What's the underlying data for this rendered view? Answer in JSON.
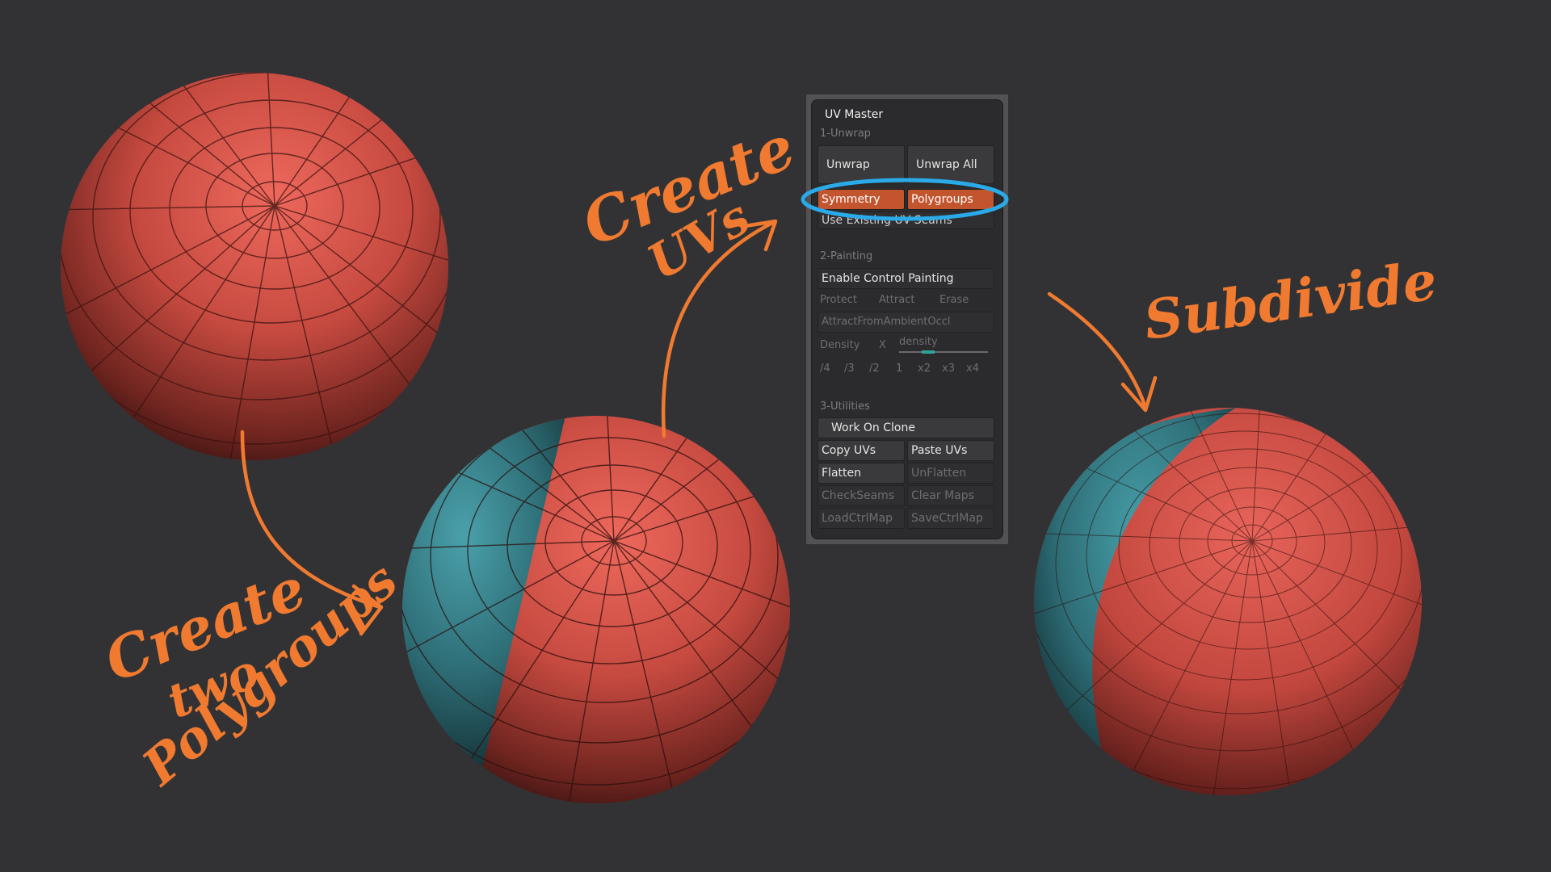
{
  "annotations": {
    "create_uvs_line1": "Create",
    "create_uvs_line2": "UVs",
    "subdivide": "Subdivide",
    "create_polygroups_line1": "Create",
    "create_polygroups_line2": "two",
    "create_polygroups_line3": "Polygroups",
    "color": "#f07a30",
    "highlight_color": "#2aaae8"
  },
  "uv_master": {
    "title": "UV Master",
    "unwrap_header": "1-Unwrap",
    "unwrap": "Unwrap",
    "unwrap_all": "Unwrap All",
    "symmetry": "Symmetry",
    "polygroups": "Polygroups",
    "use_existing_uv_seams": "Use Existing UV Seams",
    "painting_header": "2-Painting",
    "enable_control_painting": "Enable Control Painting",
    "protect": "Protect",
    "attract": "Attract",
    "erase": "Erase",
    "attract_from_ambient_occl": "AttractFromAmbientOccl",
    "density": "Density",
    "density_x": "X",
    "density_slider": "density",
    "density_buttons": [
      "/4",
      "/3",
      "/2",
      "1",
      "x2",
      "x3",
      "x4"
    ],
    "utilities_header": "3-Utilities",
    "work_on_clone": "Work On Clone",
    "copy_uvs": "Copy UVs",
    "paste_uvs": "Paste UVs",
    "flatten": "Flatten",
    "unflatten": "UnFlatten",
    "check_seams": "CheckSeams",
    "clear_maps": "Clear Maps",
    "load_ctrl_map": "LoadCtrlMap",
    "save_ctrl_map": "SaveCtrlMap",
    "active_color": "#c2552e"
  },
  "colors": {
    "background": "#323235",
    "sphere_red": "#c0483e",
    "sphere_teal": "#2f6f78"
  }
}
